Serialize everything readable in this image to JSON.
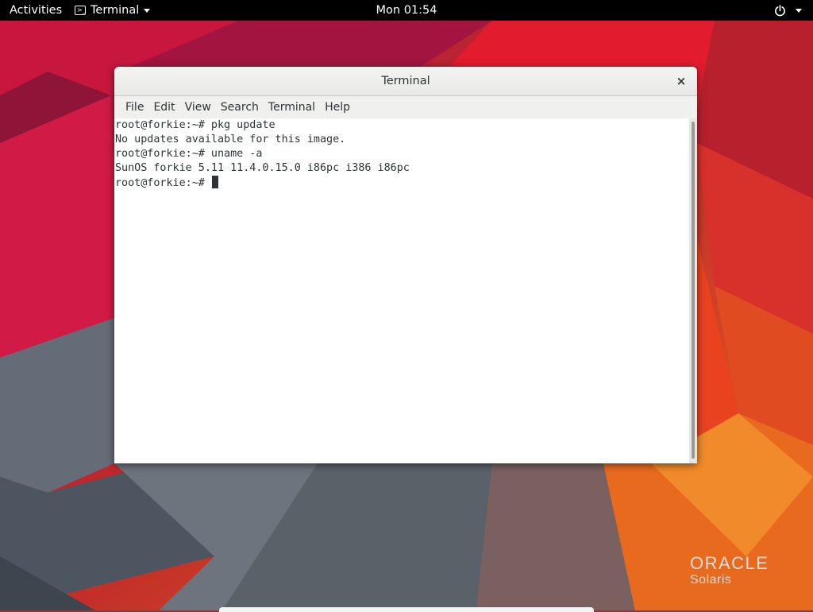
{
  "topbar": {
    "activities": "Activities",
    "app_name": "Terminal",
    "clock": "Mon 01:54",
    "icons": [
      "terminal-icon",
      "chevron-down-icon",
      "power-icon",
      "chevron-down-icon"
    ]
  },
  "window": {
    "title": "Terminal",
    "close_glyph": "×",
    "menu": {
      "file": "File",
      "edit": "Edit",
      "view": "View",
      "search": "Search",
      "terminal": "Terminal",
      "help": "Help"
    },
    "lines": [
      "root@forkie:~# pkg update",
      "No updates available for this image.",
      "root@forkie:~# uname -a",
      "SunOS forkie 5.11 11.4.0.15.0 i86pc i386 i86pc",
      "root@forkie:~# "
    ]
  },
  "branding": {
    "company": "ORACLE",
    "product": "Solaris"
  },
  "colors": {
    "topbar": "#000000",
    "terminal_bg": "#ffffff",
    "terminal_fg": "#2e3436",
    "wallpaper_red": "#d9163a",
    "wallpaper_orange": "#f06a1e",
    "wallpaper_gray": "#5a6870"
  }
}
